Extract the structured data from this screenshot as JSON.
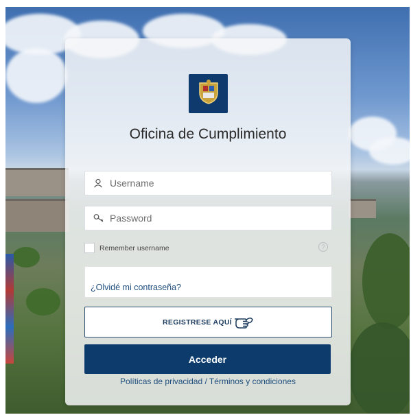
{
  "card": {
    "title": "Oficina de Cumplimiento",
    "logo": {
      "icon": "university-crest-icon",
      "background": "#0e3a6e"
    }
  },
  "form": {
    "username": {
      "value": "",
      "placeholder": "Username",
      "icon": "user-icon"
    },
    "password": {
      "value": "",
      "placeholder": "Password",
      "icon": "key-icon"
    },
    "remember": {
      "label": "Remember username",
      "checked": false
    },
    "help_icon": "question-circle-icon",
    "forgot_link": "¿Olvidé mi contraseña?",
    "register_label": "REGISTRESE AQUÍ",
    "register_icon": "pointing-hand-icon",
    "login_label": "Acceder",
    "policies_link": "Políticas de privacidad / Términos y condiciones"
  },
  "colors": {
    "primary": "#0d3c6c",
    "link": "#1f4e7f"
  }
}
